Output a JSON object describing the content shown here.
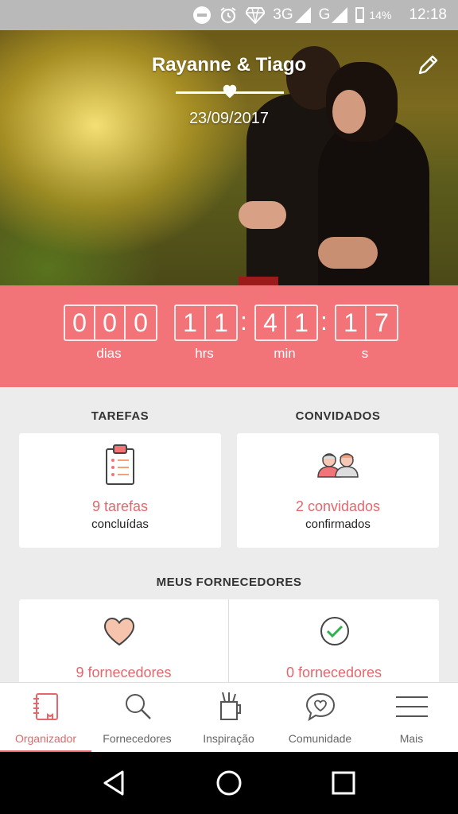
{
  "status_bar": {
    "network1": "3G",
    "network2": "G",
    "battery": "14%",
    "time": "12:18"
  },
  "hero": {
    "couple_names": "Rayanne & Tiago",
    "wedding_date": "23/09/2017"
  },
  "countdown": {
    "days": [
      "0",
      "0",
      "0"
    ],
    "hours": [
      "1",
      "1"
    ],
    "minutes": [
      "4",
      "1"
    ],
    "seconds": [
      "1",
      "7"
    ],
    "separator": ":",
    "labels": {
      "days": "dias",
      "hours": "hrs",
      "minutes": "min",
      "seconds": "s"
    }
  },
  "tasks": {
    "title": "TAREFAS",
    "count": "9 tarefas",
    "sub": "concluídas"
  },
  "guests": {
    "title": "CONVIDADOS",
    "count": "2 convidados",
    "sub": "confirmados"
  },
  "vendors": {
    "title": "MEUS FORNECEDORES",
    "favorites_count": "9 fornecedores",
    "hired_count": "0 fornecedores"
  },
  "bottom_nav": [
    {
      "label": "Organizador",
      "icon": "notebook-icon",
      "active": true
    },
    {
      "label": "Fornecedores",
      "icon": "search-icon",
      "active": false
    },
    {
      "label": "Inspiração",
      "icon": "jar-icon",
      "active": false
    },
    {
      "label": "Comunidade",
      "icon": "chat-heart-icon",
      "active": false
    },
    {
      "label": "Mais",
      "icon": "menu-icon",
      "active": false
    }
  ],
  "colors": {
    "accent": "#f27479",
    "accent_text": "#e5676c",
    "status_bar": "#b9b9b9"
  }
}
